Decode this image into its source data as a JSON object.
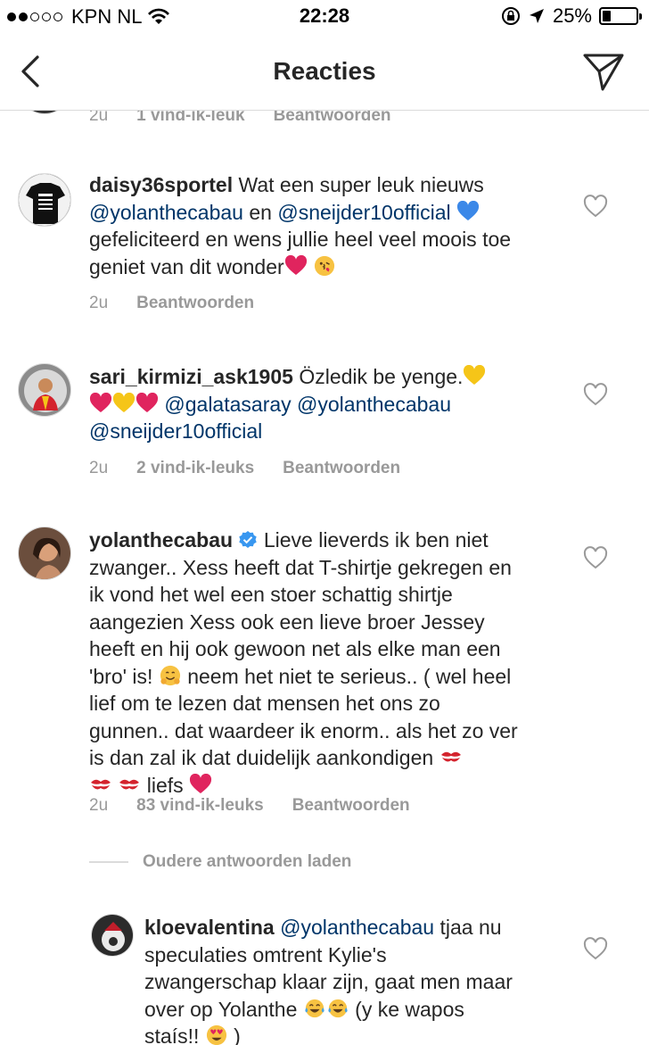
{
  "status_bar": {
    "carrier": "KPN NL",
    "time": "22:28",
    "battery": "25%",
    "battery_level": 0.25,
    "signal_bars_filled": 2,
    "signal_bars_total": 5
  },
  "nav": {
    "title": "Reacties",
    "back_icon": "chevron-left-icon",
    "send_icon": "direct-send-icon"
  },
  "top_meta": {
    "time": "2u",
    "likes": "1 vind-ik-leuk",
    "reply": "Beantwoorden"
  },
  "comments": [
    {
      "username": "daisy36sportel",
      "text_1": "Wat een super leuk nieuws",
      "mention_1": "@yolanthecabau",
      "text_2": "en",
      "mention_2": "@sneijder10official",
      "text_3": "gefeliciteerd en wens jullie heel veel moois toe",
      "text_4": "geniet van dit wonder",
      "time": "2u",
      "reply": "Beantwoorden"
    },
    {
      "username": "sari_kirmizi_ask1905",
      "text_1": "Özledik be yenge.",
      "mention_1": "@galatasaray",
      "mention_2": "@yolanthecabau",
      "mention_3": "@sneijder10official",
      "time": "2u",
      "likes": "2 vind-ik-leuks",
      "reply": "Beantwoorden"
    },
    {
      "username": "yolanthecabau",
      "verified": true,
      "text_1": "Lieve lieverds ik ben niet",
      "text_2": "zwanger.. Xess heeft dat T-shirtje gekregen en",
      "text_3": "ik vond het wel een stoer schattig shirtje",
      "text_4": "aangezien Xess ook een lieve broer Jessey",
      "text_5": "heeft en hij ook gewoon net als elke man een",
      "text_6": "'bro' is!",
      "text_7": "neem het niet te serieus.. ( wel heel",
      "text_8": "lief om te lezen dat mensen het ons zo",
      "text_9": "gunnen.. dat waardeer ik enorm.. als het zo ver",
      "text_10": "is dan zal ik dat duidelijk aankondigen",
      "text_11": "liefs",
      "time": "2u",
      "likes": "83 vind-ik-leuks",
      "reply": "Beantwoorden"
    }
  ],
  "load_more": "Oudere antwoorden laden",
  "reply_comment": {
    "username": "kloevalentina",
    "mention_1": "@yolanthecabau",
    "text_1": "tjaa nu",
    "text_2": "speculaties omtrent Kylie's",
    "text_3": "zwangerschap klaar zijn, gaat men maar",
    "text_4": "over op Yolanthe",
    "text_5": "(y ke wapos",
    "text_6": "staís!!",
    "text_7": ")"
  },
  "colors": {
    "text": "#262626",
    "mention": "#003569",
    "meta": "#999999",
    "divider": "#dbdbdb",
    "heart_red": "#e0245e",
    "heart_blue": "#3b88e8",
    "heart_yellow": "#f5c518",
    "verified_blue": "#3897f0"
  }
}
